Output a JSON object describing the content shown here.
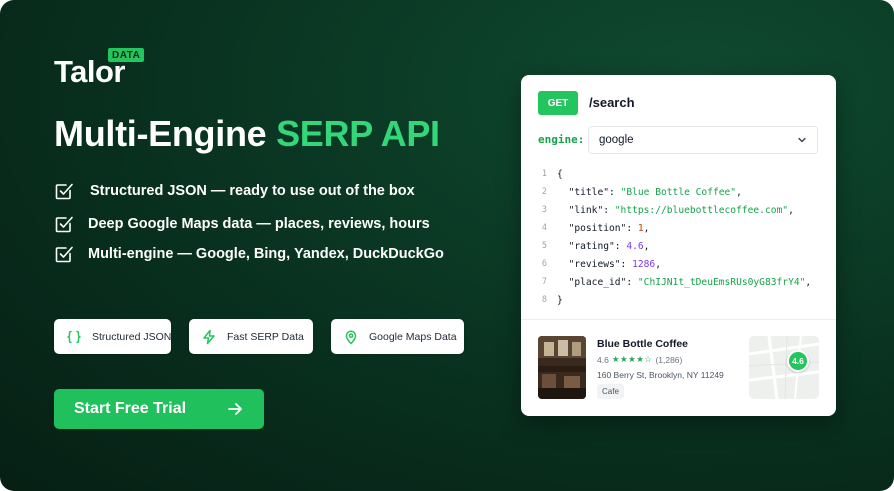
{
  "brand": {
    "name": "Talor",
    "badge": "DATA"
  },
  "headline": {
    "part1": "Multi-Engine ",
    "accent": "SERP API"
  },
  "features": [
    {
      "text": "Structured JSON — ready to use out of the box",
      "icon": "checkbox-icon"
    },
    {
      "text": "Deep Google Maps data — places, reviews, hours",
      "icon": "checkbox-icon"
    },
    {
      "text": "Multi-engine — Google, Bing, Yandex, DuckDuckGo",
      "icon": "checkbox-icon"
    }
  ],
  "pills": [
    {
      "text": "Structured JSON",
      "icon": "curly-braces-icon"
    },
    {
      "text": "Fast SERP Data",
      "icon": "lightning-icon"
    },
    {
      "text": "Google Maps Data",
      "icon": "map-pin-icon"
    }
  ],
  "cta": {
    "label": "Start Free Trial",
    "icon": "arrow-right-icon"
  },
  "request": {
    "method": "GET",
    "endpoint": "/search",
    "engine_label": "engine:",
    "engine_value": "google"
  },
  "code": {
    "line_numbers": [
      "1",
      "2",
      "3",
      "4",
      "5",
      "6",
      "7",
      "8"
    ],
    "open": "{",
    "close": "}",
    "fields": [
      {
        "key": "\"title\"",
        "value": "\"Blue Bottle Coffee\"",
        "type": "string"
      },
      {
        "key": "\"link\"",
        "value": "\"https://bluebottlecoffee.com\"",
        "type": "string"
      },
      {
        "key": "\"position\"",
        "value": "1",
        "type": "number"
      },
      {
        "key": "\"rating\"",
        "value": "4.6",
        "type": "number-alt"
      },
      {
        "key": "\"reviews\"",
        "value": "1286",
        "type": "number-alt"
      },
      {
        "key": "\"place_id\"",
        "value": "\"ChIJN1t_tDeuEmsRUs0yG83frY4\"",
        "type": "string"
      }
    ]
  },
  "place": {
    "name": "Blue Bottle Coffee",
    "rating": "4.6",
    "stars": "★★★★☆",
    "reviews": "(1,286)",
    "address": "160 Berry St, Brooklyn, NY 11249",
    "category": "Cafe",
    "map_pin_label": "4.6"
  },
  "colors": {
    "accent": "#22c55e",
    "background": "#082d1d"
  }
}
